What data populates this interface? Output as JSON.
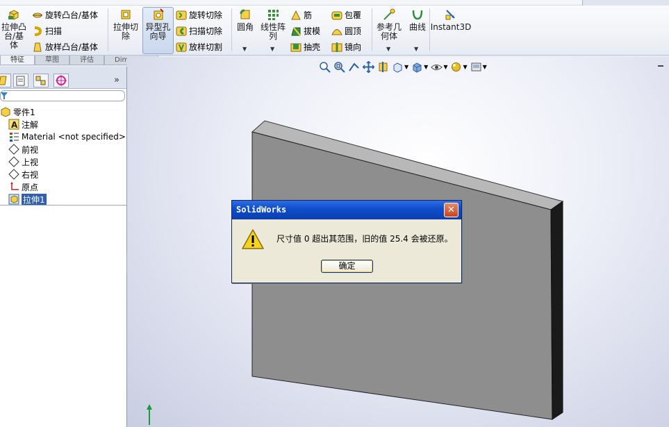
{
  "ribbon": {
    "extrude_boss": "拉伸凸台/基体",
    "revolve_boss": "旋转凸台/基体",
    "sweep": "扫描",
    "loft_boss": "放样凸台/基体",
    "extrude_cut": "拉伸切除",
    "hole_wizard": "异型孔向导",
    "revolve_cut": "旋转切除",
    "sweep_cut": "扫描切除",
    "loft_cut": "放样切割",
    "fillet": "圆角",
    "linear_pattern": "线性阵列",
    "rib": "筋",
    "draft": "拔模",
    "shell": "抽壳",
    "wrap": "包覆",
    "dome": "圆顶",
    "mirror": "镜向",
    "ref_geometry": "参考几何体",
    "curves": "曲线",
    "instant3d": "Instant3D"
  },
  "tabs": [
    "特征",
    "草图",
    "评估",
    "DimXpert"
  ],
  "tree": {
    "root": "零件1",
    "annotations": "注解",
    "material": "Material <not specified>",
    "front": "前视",
    "top": "上视",
    "right": "右视",
    "origin": "原点",
    "extrude1": "拉伸1"
  },
  "dialog": {
    "title": "SolidWorks",
    "message": "尺寸值 0 超出其范围，旧的值 25.4 会被还原。",
    "ok": "确定"
  },
  "colors": {
    "selection": "#2f5fae",
    "titlebar": "#0f4fcc",
    "part_face": "#8e8e8e"
  }
}
